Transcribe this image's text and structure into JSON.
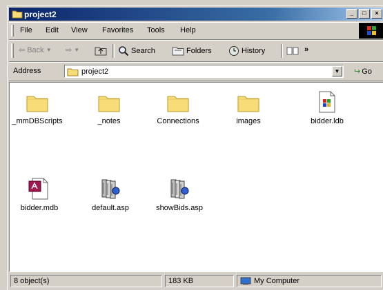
{
  "window": {
    "title": "project2"
  },
  "menu": [
    "File",
    "Edit",
    "View",
    "Favorites",
    "Tools",
    "Help"
  ],
  "toolbar": {
    "back": "Back",
    "search": "Search",
    "folders": "Folders",
    "history": "History",
    "more": "»"
  },
  "address": {
    "label": "Address",
    "value": "project2",
    "go": "Go"
  },
  "files": [
    {
      "name": "_mmDBScripts",
      "icon": "folder-icon"
    },
    {
      "name": "_notes",
      "icon": "folder-icon"
    },
    {
      "name": "Connections",
      "icon": "folder-icon"
    },
    {
      "name": "images",
      "icon": "folder-icon"
    },
    {
      "name": "bidder.ldb",
      "icon": "ldb-file-icon"
    },
    {
      "name": "bidder.mdb",
      "icon": "access-db-icon"
    },
    {
      "name": "default.asp",
      "icon": "asp-file-icon"
    },
    {
      "name": "showBids.asp",
      "icon": "asp-file-icon"
    }
  ],
  "status": {
    "objects": "8 object(s)",
    "size": "183 KB",
    "zone": "My Computer"
  },
  "colors": {
    "titlebar": "#0a246a",
    "folder": "#f8dc78",
    "face": "#d4d0c8"
  }
}
